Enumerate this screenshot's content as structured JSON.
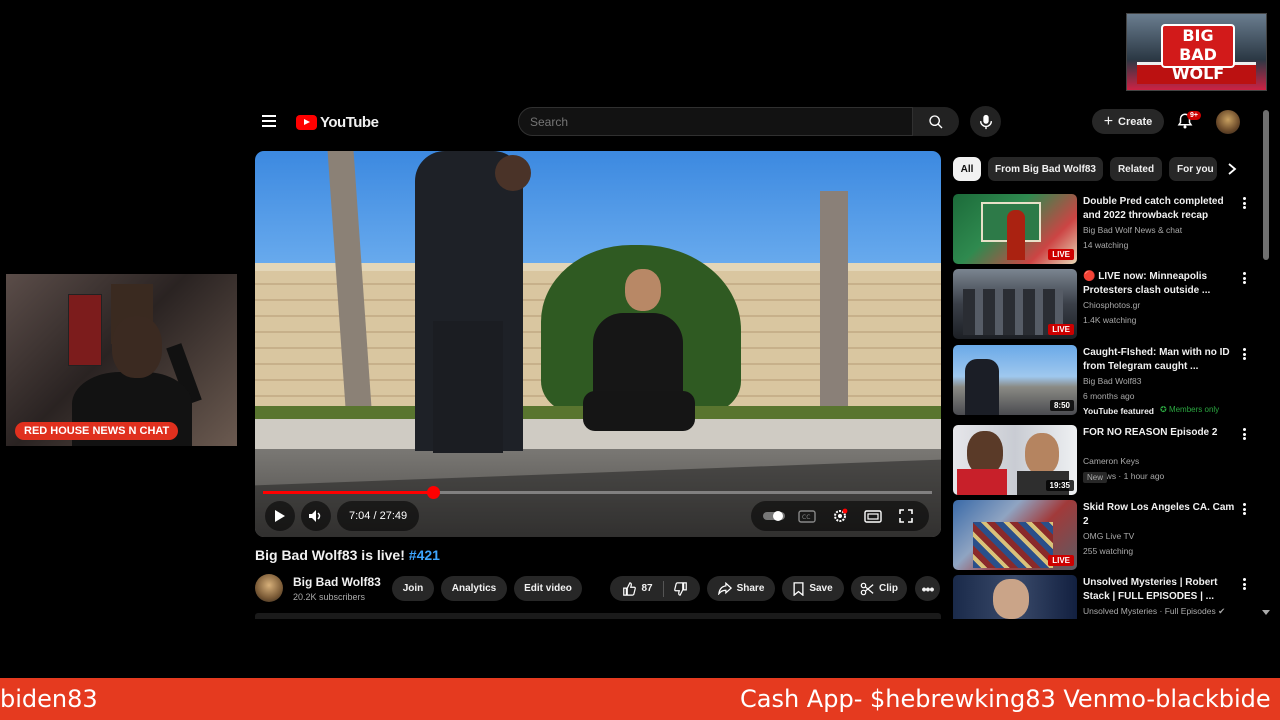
{
  "overlay": {
    "logo_text": "BIG BAD WOLF",
    "cam_label": "RED HOUSE NEWS N CHAT",
    "ticker_left": "biden83",
    "ticker_right": "Cash App- $hebrewking83 Venmo-blackbide"
  },
  "header": {
    "brand": "YouTube",
    "search_placeholder": "Search",
    "create_label": "Create",
    "notif_badge": "9+"
  },
  "player": {
    "time": "7:04 / 27:49",
    "progress": 0.254,
    "accent": "#ff0000"
  },
  "video": {
    "title": "Big Bad Wolf83 is live!",
    "hashtag": "#421",
    "channel": "Big Bad Wolf83",
    "subscribers": "20.2K subscribers",
    "join_label": "Join",
    "analytics_label": "Analytics",
    "edit_label": "Edit video",
    "likes": "87",
    "share_label": "Share",
    "save_label": "Save",
    "clip_label": "Clip"
  },
  "chips": [
    "All",
    "From Big Bad Wolf83",
    "Related",
    "For you"
  ],
  "recommendations": [
    {
      "title": "Double Pred catch completed and 2022 throwback recap",
      "channel": "Big Bad Wolf News & chat",
      "meta": "14 watching",
      "badge": "LIVE"
    },
    {
      "title": "🔴 LIVE now: Minneapolis Protesters clash outside ...",
      "channel": "Chiosphotos.gr",
      "meta": "1.4K watching",
      "badge": "LIVE"
    },
    {
      "title": "Caught-FIshed: Man with no ID from Telegram caught ...",
      "channel": "Big Bad Wolf83",
      "meta": "6 months ago",
      "badge": "8:50",
      "featured": "YouTube featured",
      "members": "Members only"
    },
    {
      "title": "FOR NO REASON Episode 2",
      "channel": "Cameron Keys",
      "meta": "10 views · 1 hour ago",
      "badge": "19:35",
      "tag": "New"
    },
    {
      "title": "Skid Row Los Angeles CA. Cam 2",
      "channel": "OMG Live TV",
      "meta": "255 watching",
      "badge": "LIVE"
    },
    {
      "title": "Unsolved Mysteries | Robert Stack | FULL EPISODES | ...",
      "channel": "Unsolved Mysteries · Full Episodes",
      "meta": "",
      "badge": ""
    }
  ]
}
